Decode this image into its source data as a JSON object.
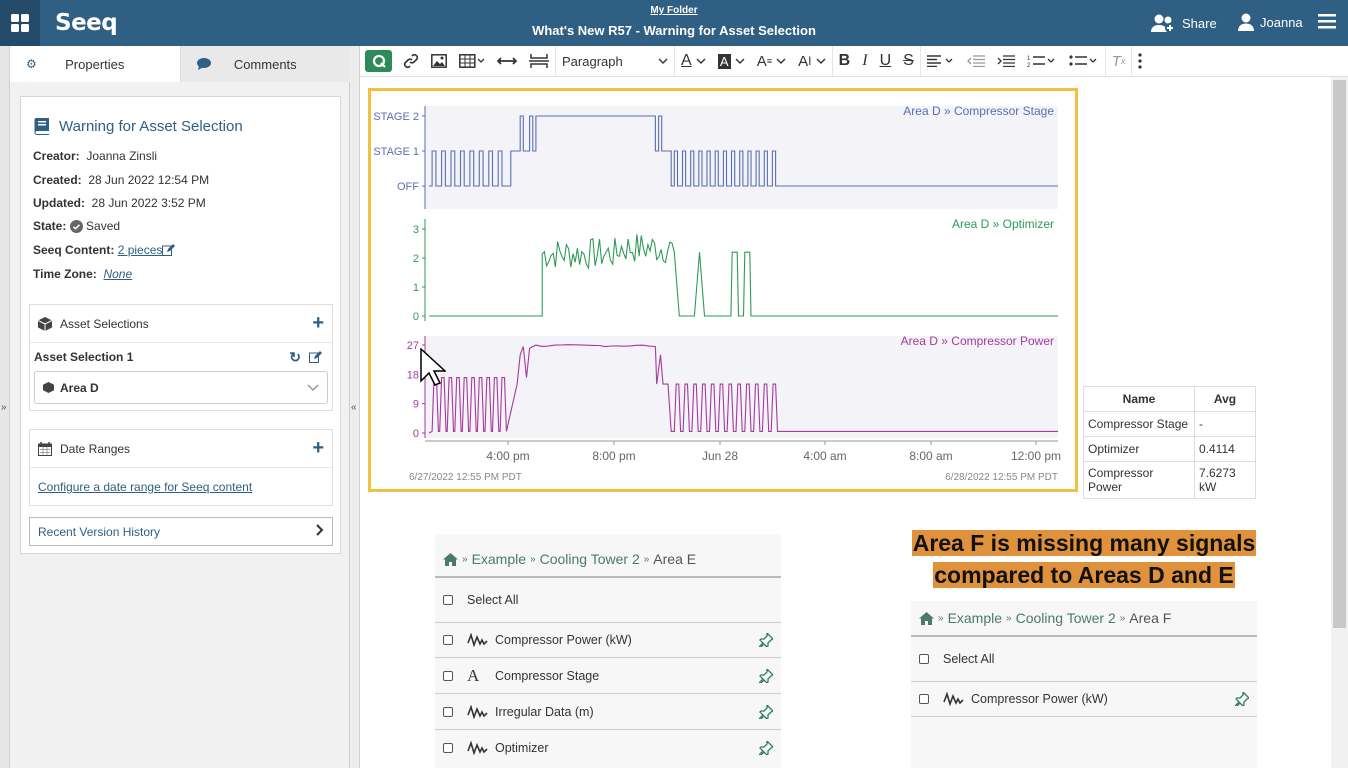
{
  "header": {
    "logo": "Seeq",
    "folder_link": "My Folder",
    "title": "What's New R57 - Warning for Asset Selection",
    "share_label": "Share",
    "user_name": "Joanna"
  },
  "tabs": {
    "properties": "Properties",
    "comments": "Comments"
  },
  "properties": {
    "title": "Warning for Asset Selection",
    "creator_label": "Creator:",
    "creator": "Joanna Zinsli",
    "created_label": "Created:",
    "created": "28 Jun 2022 12:54 PM",
    "updated_label": "Updated:",
    "updated": "28 Jun 2022 3:52 PM",
    "state_label": "State:",
    "state": "Saved",
    "content_label": "Seeq Content:",
    "content": "2 pieces",
    "timezone_label": "Time Zone:",
    "timezone": "None"
  },
  "asset_selections": {
    "header": "Asset Selections",
    "item_label": "Asset Selection 1",
    "selected": "Area D"
  },
  "date_ranges": {
    "header": "Date Ranges",
    "configure_link": "Configure a date range for Seeq content"
  },
  "version_history": "Recent Version History",
  "toolbar": {
    "paragraph": "Paragraph"
  },
  "chart_data": {
    "type": "line",
    "x_start": "6/27/2022 12:55 PM  PDT",
    "x_end": "6/28/2022 12:55 PM  PDT",
    "x_ticks": [
      "4:00 pm",
      "8:00 pm",
      "Jun 28",
      "4:00 am",
      "8:00 am",
      "12:00 pm"
    ],
    "lanes": [
      {
        "name": "Area D » Compressor Stage",
        "color": "#5a6fb0",
        "ticks": [
          "STAGE 2",
          "STAGE 1",
          "OFF"
        ],
        "ylim": [
          0,
          2
        ]
      },
      {
        "name": "Area D » Optimizer",
        "color": "#2e9a58",
        "ticks": [
          "3",
          "2",
          "1",
          "0"
        ],
        "ylim": [
          0,
          3
        ]
      },
      {
        "name": "Area D » Compressor Power",
        "color": "#a63a9e",
        "ticks": [
          "27",
          "18",
          "9",
          "0"
        ],
        "ylim": [
          0,
          27
        ]
      }
    ]
  },
  "stats_table": {
    "headers": [
      "Name",
      "Avg"
    ],
    "rows": [
      [
        "Compressor Stage",
        "-"
      ],
      [
        "Optimizer",
        "0.4114"
      ],
      [
        "Compressor Power",
        "7.6273 kW"
      ]
    ]
  },
  "heading": {
    "line1": "Area F is missing many signals",
    "line2": "compared to Areas D and E"
  },
  "area_e_panel": {
    "crumbs": [
      "Example",
      "Cooling Tower 2",
      "Area E"
    ],
    "select_all": "Select All",
    "items": [
      {
        "label": "Compressor Power (kW)",
        "icon": "signal-icon"
      },
      {
        "label": "Compressor Stage",
        "icon": "string-signal-icon"
      },
      {
        "label": "Irregular Data (m)",
        "icon": "signal-icon"
      },
      {
        "label": "Optimizer",
        "icon": "signal-icon"
      }
    ]
  },
  "area_f_panel": {
    "crumbs": [
      "Example",
      "Cooling Tower 2",
      "Area F"
    ],
    "select_all": "Select All",
    "items": [
      {
        "label": "Compressor Power (kW)",
        "icon": "signal-icon"
      }
    ]
  }
}
